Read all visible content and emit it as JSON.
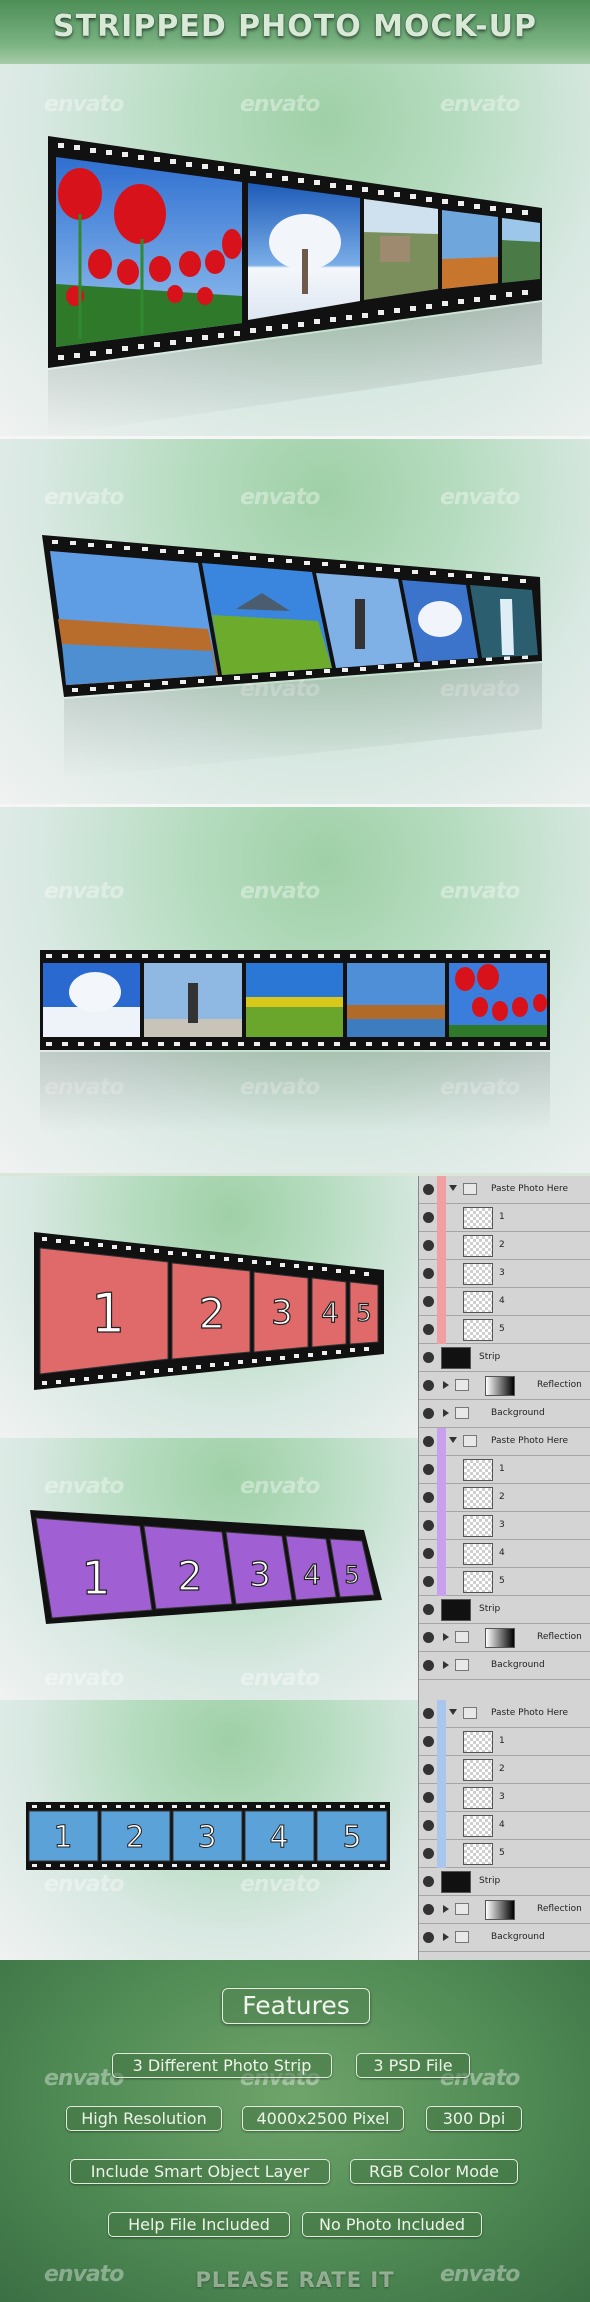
{
  "header": {
    "title": "STRIPPED PHOTO  MOCK-UP"
  },
  "watermark": "envato",
  "mockups": {
    "numbered_frames": [
      "1",
      "2",
      "3",
      "4",
      "5"
    ]
  },
  "layers_panel": {
    "group_name": "Paste Photo Here",
    "layer_names": [
      "1",
      "2",
      "3",
      "4",
      "5"
    ],
    "strip": "Strip",
    "reflection": "Reflection",
    "background": "Background"
  },
  "features": {
    "title": "Features",
    "items": [
      "3 Different Photo Strip",
      "3 PSD File",
      "High Resolution",
      "4000x2500 Pixel",
      "300 Dpi",
      "Include Smart Object Layer",
      "RGB Color Mode",
      "Help File Included",
      "No Photo Included"
    ]
  },
  "footer": {
    "text": "PLEASE RATE IT"
  },
  "colors": {
    "red_strip": "#e06a6a",
    "purple_strip": "#a05fd2",
    "blue_strip": "#5ba2d8",
    "red_tag": "#f0a0a0",
    "purple_tag": "#c9a0ef",
    "blue_tag": "#a8c6ee"
  }
}
